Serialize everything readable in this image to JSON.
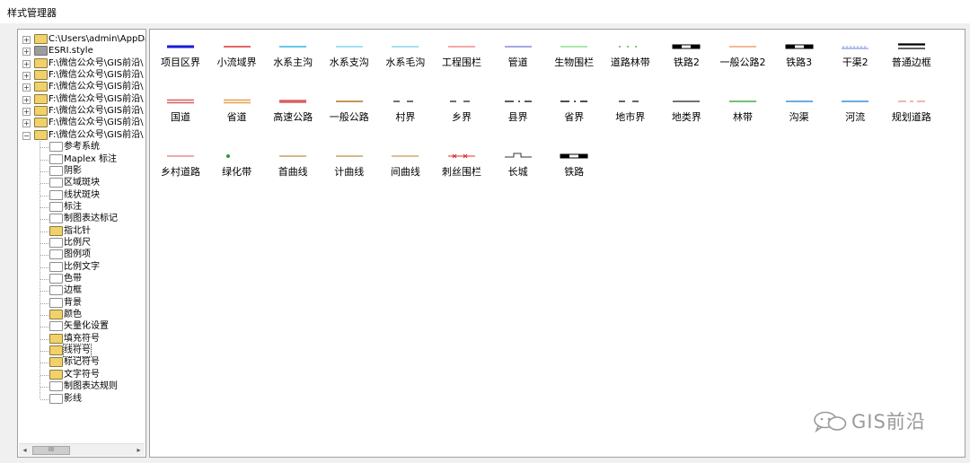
{
  "window": {
    "title": "样式管理器"
  },
  "tree": {
    "roots": [
      {
        "label": "C:\\Users\\admin\\AppData\\",
        "expander": "+",
        "icon": "folder-icon"
      },
      {
        "label": "ESRI.style",
        "expander": "+",
        "icon": "style-file-icon"
      },
      {
        "label": "F:\\微信公众号\\GIS前沿\\",
        "expander": "+",
        "icon": "folder-icon"
      },
      {
        "label": "F:\\微信公众号\\GIS前沿\\",
        "expander": "+",
        "icon": "folder-icon"
      },
      {
        "label": "F:\\微信公众号\\GIS前沿\\",
        "expander": "+",
        "icon": "folder-icon"
      },
      {
        "label": "F:\\微信公众号\\GIS前沿\\",
        "expander": "+",
        "icon": "folder-icon"
      },
      {
        "label": "F:\\微信公众号\\GIS前沿\\",
        "expander": "+",
        "icon": "folder-icon"
      },
      {
        "label": "F:\\微信公众号\\GIS前沿\\",
        "expander": "+",
        "icon": "folder-icon"
      },
      {
        "label": "F:\\微信公众号\\GIS前沿\\",
        "expander": "−",
        "icon": "open-folder-icon"
      }
    ],
    "children": [
      {
        "label": "参考系统",
        "icon": "white-folder-icon"
      },
      {
        "label": "Maplex 标注",
        "icon": "white-folder-icon"
      },
      {
        "label": "阴影",
        "icon": "white-folder-icon"
      },
      {
        "label": "区域斑块",
        "icon": "white-folder-icon"
      },
      {
        "label": "线状斑块",
        "icon": "white-folder-icon"
      },
      {
        "label": "标注",
        "icon": "white-folder-icon"
      },
      {
        "label": "制图表达标记",
        "icon": "white-folder-icon"
      },
      {
        "label": "指北针",
        "icon": "yellow-folder-icon"
      },
      {
        "label": "比例尺",
        "icon": "white-folder-icon"
      },
      {
        "label": "图例项",
        "icon": "white-folder-icon"
      },
      {
        "label": "比例文字",
        "icon": "white-folder-icon"
      },
      {
        "label": "色带",
        "icon": "white-folder-icon"
      },
      {
        "label": "边框",
        "icon": "white-folder-icon"
      },
      {
        "label": "背景",
        "icon": "white-folder-icon"
      },
      {
        "label": "颜色",
        "icon": "yellow-folder-icon"
      },
      {
        "label": "矢量化设置",
        "icon": "white-folder-icon"
      },
      {
        "label": "填充符号",
        "icon": "yellow-folder-icon"
      },
      {
        "label": "线符号",
        "icon": "open-folder-icon",
        "selected": true
      },
      {
        "label": "标记符号",
        "icon": "yellow-folder-icon"
      },
      {
        "label": "文字符号",
        "icon": "yellow-folder-icon"
      },
      {
        "label": "制图表达规则",
        "icon": "white-folder-icon"
      },
      {
        "label": "影线",
        "icon": "white-folder-icon"
      }
    ],
    "scrollbar": {
      "left_arrow": "◂",
      "thumb": "III",
      "right_arrow": "▸"
    }
  },
  "symbols": [
    {
      "label": "项目区界",
      "icon": "line-thick-blue",
      "color": "#1a1adc"
    },
    {
      "label": "小流域界",
      "icon": "line-red",
      "color": "#e03030"
    },
    {
      "label": "水系主沟",
      "icon": "line-cyan",
      "color": "#34b6e6"
    },
    {
      "label": "水系支沟",
      "icon": "line-light-cyan",
      "color": "#7fd8ec"
    },
    {
      "label": "水系毛沟",
      "icon": "line-light-cyan",
      "color": "#8ad6ea"
    },
    {
      "label": "工程围栏",
      "icon": "line-pink",
      "color": "#f08a8a"
    },
    {
      "label": "管道",
      "icon": "line-purple",
      "color": "#8a8ae0"
    },
    {
      "label": "生物围栏",
      "icon": "line-green",
      "color": "#8ee08e"
    },
    {
      "label": "道路林带",
      "icon": "dotted-green",
      "color": "#5ab84a"
    },
    {
      "label": "铁路2",
      "icon": "railway-icon",
      "color": "#000000"
    },
    {
      "label": "一般公路2",
      "icon": "line-orange",
      "color": "#f4a070"
    },
    {
      "label": "铁路3",
      "icon": "railway-icon",
      "color": "#000000"
    },
    {
      "label": "干渠2",
      "icon": "ticked-blue",
      "color": "#6a8ae6"
    },
    {
      "label": "普通边框",
      "icon": "double-black",
      "color": "#000000"
    },
    {
      "label": "国道",
      "icon": "double-red",
      "color": "#d86060"
    },
    {
      "label": "省道",
      "icon": "double-orange",
      "color": "#e8a050"
    },
    {
      "label": "高速公路",
      "icon": "thick-red",
      "color": "#d86060"
    },
    {
      "label": "一般公路",
      "icon": "line-brown",
      "color": "#b07020"
    },
    {
      "label": "村界",
      "icon": "dash-black",
      "color": "#333333"
    },
    {
      "label": "乡界",
      "icon": "dash-black",
      "color": "#333333"
    },
    {
      "label": "县界",
      "icon": "dash-dot-black",
      "color": "#333333"
    },
    {
      "label": "省界",
      "icon": "dash-dot-black",
      "color": "#222222"
    },
    {
      "label": "地市界",
      "icon": "dash-black",
      "color": "#222222"
    },
    {
      "label": "地类界",
      "icon": "line-black",
      "color": "#444444"
    },
    {
      "label": "林带",
      "icon": "line-green",
      "color": "#4aa84a"
    },
    {
      "label": "沟渠",
      "icon": "line-blue",
      "color": "#3a90d8"
    },
    {
      "label": "河流",
      "icon": "line-blue",
      "color": "#3a90d8"
    },
    {
      "label": "规划道路",
      "icon": "dash-red",
      "color": "#d87060"
    },
    {
      "label": "乡村道路",
      "icon": "line-salmon",
      "color": "#e09090"
    },
    {
      "label": "绿化带",
      "icon": "green-dot",
      "color": "#2e9a2e"
    },
    {
      "label": "首曲线",
      "icon": "line-tan",
      "color": "#c8a060"
    },
    {
      "label": "计曲线",
      "icon": "line-tan",
      "color": "#c8a060"
    },
    {
      "label": "间曲线",
      "icon": "line-tan",
      "color": "#d0a870"
    },
    {
      "label": "刺丝围栏",
      "icon": "barbed-wire",
      "color": "#d83030"
    },
    {
      "label": "长城",
      "icon": "wall-icon",
      "color": "#333333"
    },
    {
      "label": "铁路",
      "icon": "railway-icon",
      "color": "#000000"
    }
  ],
  "watermark": {
    "text": "GIS前沿",
    "icon": "wechat-icon"
  }
}
